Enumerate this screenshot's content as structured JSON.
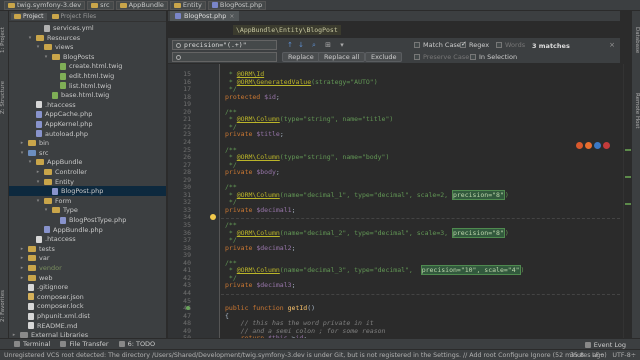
{
  "breadcrumb": [
    "twig.symfony-3.dev",
    "src",
    "AppBundle",
    "Entity",
    "BlogPost.php"
  ],
  "left_stripe": {
    "project": "1: Project",
    "structure": "Z: Structure",
    "favorites": "2: Favorites"
  },
  "right_stripe": {
    "database": "Database",
    "remote_host": "Remote Host"
  },
  "panel_tabs": [
    "Project",
    "Project Files"
  ],
  "tree": [
    {
      "label": "services.yml",
      "icon": "yml",
      "indent": 3,
      "arrow": ""
    },
    {
      "label": "Resources",
      "icon": "folder",
      "indent": 2,
      "arrow": "▾"
    },
    {
      "label": "views",
      "icon": "folder",
      "indent": 3,
      "arrow": "▾"
    },
    {
      "label": "BlogPosts",
      "icon": "folder",
      "indent": 4,
      "arrow": "▾"
    },
    {
      "label": "create.html.twig",
      "icon": "twig",
      "indent": 5,
      "arrow": ""
    },
    {
      "label": "edit.html.twig",
      "icon": "twig",
      "indent": 5,
      "arrow": ""
    },
    {
      "label": "list.html.twig",
      "icon": "twig",
      "indent": 5,
      "arrow": ""
    },
    {
      "label": "base.html.twig",
      "icon": "twig",
      "indent": 4,
      "arrow": ""
    },
    {
      "label": ".htaccess",
      "icon": "text",
      "indent": 2,
      "arrow": ""
    },
    {
      "label": "AppCache.php",
      "icon": "php",
      "indent": 2,
      "arrow": ""
    },
    {
      "label": "AppKernel.php",
      "icon": "php",
      "indent": 2,
      "arrow": ""
    },
    {
      "label": "autoload.php",
      "icon": "php",
      "indent": 2,
      "arrow": ""
    },
    {
      "label": "bin",
      "icon": "folder",
      "indent": 1,
      "arrow": "▸"
    },
    {
      "label": "src",
      "icon": "src",
      "indent": 1,
      "arrow": "▾"
    },
    {
      "label": "AppBundle",
      "icon": "folder",
      "indent": 2,
      "arrow": "▾"
    },
    {
      "label": "Controller",
      "icon": "folder",
      "indent": 3,
      "arrow": "▸"
    },
    {
      "label": "Entity",
      "icon": "folder",
      "indent": 3,
      "arrow": "▾"
    },
    {
      "label": "BlogPost.php",
      "icon": "php",
      "indent": 4,
      "arrow": "",
      "selected": true
    },
    {
      "label": "Form",
      "icon": "folder",
      "indent": 3,
      "arrow": "▾"
    },
    {
      "label": "Type",
      "icon": "folder",
      "indent": 4,
      "arrow": "▾"
    },
    {
      "label": "BlogPostType.php",
      "icon": "php",
      "indent": 5,
      "arrow": ""
    },
    {
      "label": "AppBundle.php",
      "icon": "php",
      "indent": 3,
      "arrow": ""
    },
    {
      "label": ".htaccess",
      "icon": "text",
      "indent": 2,
      "arrow": ""
    },
    {
      "label": "tests",
      "icon": "folder",
      "indent": 1,
      "arrow": "▸"
    },
    {
      "label": "var",
      "icon": "folder",
      "indent": 1,
      "arrow": "▸"
    },
    {
      "label": "vendor",
      "icon": "folder",
      "indent": 1,
      "arrow": "▸",
      "vendor": true
    },
    {
      "label": "web",
      "icon": "folder",
      "indent": 1,
      "arrow": "▸"
    },
    {
      "label": ".gitignore",
      "icon": "text",
      "indent": 1,
      "arrow": ""
    },
    {
      "label": "composer.json",
      "icon": "json",
      "indent": 1,
      "arrow": ""
    },
    {
      "label": "composer.lock",
      "icon": "text",
      "indent": 1,
      "arrow": ""
    },
    {
      "label": "phpunit.xml.dist",
      "icon": "text",
      "indent": 1,
      "arrow": ""
    },
    {
      "label": "README.md",
      "icon": "text",
      "indent": 1,
      "arrow": ""
    },
    {
      "label": "External Libraries",
      "icon": "lib",
      "indent": 0,
      "arrow": "▸"
    }
  ],
  "editor_tab": {
    "label": "BlogPost.php",
    "close": "×"
  },
  "namespace_label": "\\AppBundle\\Entity\\BlogPost",
  "search": {
    "find_value": "precision=\"(.+)\"",
    "replace_value": "",
    "replace_label": "Replace",
    "replace_all_label": "Replace all",
    "exclude_label": "Exclude",
    "match_case_label": "Match Case",
    "match_case_checked": false,
    "regex_label": "Regex",
    "regex_checked": true,
    "words_label": "Words",
    "preserve_case_label": "Preserve Case",
    "in_selection_label": "In Selection",
    "match_count": "3 matches"
  },
  "lines": [
    {
      "n": "15",
      "html": "<span class='cmt'> * <span class='ann'>@ORM\\Id</span></span>"
    },
    {
      "n": "16",
      "html": "<span class='cmt'> * <span class='ann'>@ORM\\GeneratedValue</span>(strategy=\"AUTO\")</span>"
    },
    {
      "n": "17",
      "html": "<span class='cmt'> */</span>"
    },
    {
      "n": "18",
      "html": "<span class='kw'>protected</span> <span class='var'>$id</span>;"
    },
    {
      "n": "19",
      "html": ""
    },
    {
      "n": "20",
      "html": "<span class='cmt'>/**</span>"
    },
    {
      "n": "21",
      "html": "<span class='cmt'> * <span class='ann'>@ORM\\Column</span>(type=\"string\", name=\"title\")</span>"
    },
    {
      "n": "22",
      "html": "<span class='cmt'> */</span>"
    },
    {
      "n": "23",
      "html": "<span class='kw'>private</span> <span class='var'>$title</span>;"
    },
    {
      "n": "24",
      "html": ""
    },
    {
      "n": "25",
      "html": "<span class='cmt'>/**</span>"
    },
    {
      "n": "26",
      "html": "<span class='cmt'> * <span class='ann'>@ORM\\Column</span>(type=\"string\", name=\"body\")</span>"
    },
    {
      "n": "27",
      "html": "<span class='cmt'> */</span>"
    },
    {
      "n": "28",
      "html": "<span class='kw'>private</span> <span class='var'>$body</span>;"
    },
    {
      "n": "29",
      "html": ""
    },
    {
      "n": "30",
      "html": "<span class='cmt'>/**</span>"
    },
    {
      "n": "31",
      "html": "<span class='cmt'> * <span class='ann'>@ORM\\Column</span>(name=\"decimal_1\", type=\"decimal\", scale=2, <span class='hl'>precision=\"8\"</span>)</span>"
    },
    {
      "n": "32",
      "html": "<span class='cmt'> */</span>"
    },
    {
      "n": "33",
      "html": "<span class='kw'>private</span> <span class='var'>$decimal1</span>;"
    },
    {
      "n": "34",
      "html": ""
    },
    {
      "n": "35",
      "html": "<span class='cmt'>/**</span>"
    },
    {
      "n": "36",
      "html": "<span class='cmt'> * <span class='ann'>@ORM\\Column</span>(name=\"decimal_2\", type=\"decimal\", scale=3, <span class='hl'>precision=\"8\"</span>)</span>"
    },
    {
      "n": "37",
      "html": "<span class='cmt'> */</span>"
    },
    {
      "n": "38",
      "html": "<span class='kw'>private</span> <span class='var'>$decimal2</span>;"
    },
    {
      "n": "39",
      "html": ""
    },
    {
      "n": "40",
      "html": "<span class='cmt'>/**</span>"
    },
    {
      "n": "41",
      "html": "<span class='cmt'> * <span class='ann'>@ORM\\Column</span>(name=\"decimal_3\", type=\"decimal\",  <span class='hl'>precision=\"10\", scale=\"4\"</span>)</span>"
    },
    {
      "n": "42",
      "html": "<span class='cmt'> */</span>"
    },
    {
      "n": "43",
      "html": "<span class='kw'>private</span> <span class='var'>$decimal3</span>;"
    },
    {
      "n": "44",
      "html": ""
    },
    {
      "n": "45",
      "html": ""
    },
    {
      "n": "46",
      "html": "<span class='kw'>public function</span> <span class='fn'>getId</span>()"
    },
    {
      "n": "47",
      "html": "{"
    },
    {
      "n": "48",
      "html": "    <span class='cmt-i'>// this has the word private in it</span>"
    },
    {
      "n": "49",
      "html": "    <span class='cmt-i'>// and a semi colon ; for some reason</span>"
    },
    {
      "n": "50",
      "html": "    <span class='kw'>return</span> <span class='var'>$this</span>-><span class='var'>id</span>;"
    },
    {
      "n": "51",
      "html": "}"
    }
  ],
  "tool_windows": [
    "Terminal",
    "File Transfer",
    "6: TODO"
  ],
  "event_log": "Event Log",
  "status": {
    "message": "Unregistered VCS root detected: The directory /Users/Shared/Development/twig.symfony-3.dev is under Git, but is not registered in the Settings. // Add root  Configure  Ignore (52 minutes ago)",
    "position": "35:8",
    "line_sep": "LF÷",
    "encoding": "UTF-8÷"
  },
  "colors": {
    "accent": "#4a88c7",
    "editor_bg": "#2b2b2b",
    "panel_bg": "#3c3f41",
    "match_highlight": "#32593d"
  }
}
